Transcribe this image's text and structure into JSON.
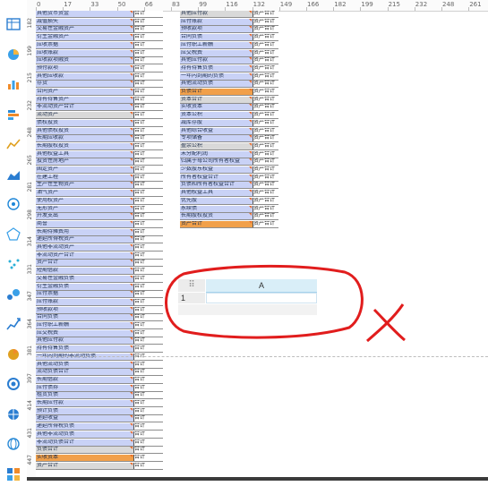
{
  "top_ruler": {
    "ticks": [
      "0",
      "17",
      "33",
      "50",
      "66",
      "83",
      "99",
      "116",
      "132",
      "149",
      "166",
      "182",
      "199",
      "215",
      "232",
      "248",
      "261"
    ]
  },
  "left_ruler": {
    "ticks": [
      "182",
      "199",
      "215",
      "232",
      "248",
      "265",
      "281",
      "298",
      "314",
      "331",
      "347",
      "364",
      "381",
      "397",
      "414",
      "431",
      "447"
    ]
  },
  "toolbar": {
    "icons": [
      "table-icon",
      "pie-chart-icon",
      "bar-chart-icon",
      "horizontal-bar-icon",
      "line-chart-icon",
      "area-chart-icon",
      "radar-chart-icon",
      "scatter-chart-icon",
      "bubble-chart-icon",
      "network-chart-icon",
      "trend-chart-icon",
      "gauge-chart-icon",
      "funnel-chart-icon",
      "globe-icon",
      "geo-icon",
      "treemap-icon"
    ]
  },
  "left_sheet": {
    "value_text": "合计",
    "rows": [
      {
        "label": "其他货币资金"
      },
      {
        "label": "减值损失"
      },
      {
        "label": "交易性金融资产"
      },
      {
        "label": "衍生金融资产"
      },
      {
        "label": "应收票据"
      },
      {
        "label": "应收账款"
      },
      {
        "label": "应收款项融资"
      },
      {
        "label": "预付款项"
      },
      {
        "label": "其他应收款"
      },
      {
        "label": "存货"
      },
      {
        "label": "合同资产"
      },
      {
        "label": "持有待售资产"
      },
      {
        "label": "非流动资产合计"
      },
      {
        "label": "流动资产"
      },
      {
        "label": "债权投资"
      },
      {
        "label": "其他债权投资"
      },
      {
        "label": "长期应收款"
      },
      {
        "label": "长期股权投资"
      },
      {
        "label": "其他权益工具"
      },
      {
        "label": "投资性房地产"
      },
      {
        "label": "固定资产"
      },
      {
        "label": "在建工程"
      },
      {
        "label": "生产性生物资产"
      },
      {
        "label": "油气资产"
      },
      {
        "label": "使用权资产"
      },
      {
        "label": "无形资产"
      },
      {
        "label": "开发支出"
      },
      {
        "label": "商誉"
      },
      {
        "label": "长期待摊费用"
      },
      {
        "label": "递延所得税资产"
      },
      {
        "label": "其他非流动资产"
      },
      {
        "label": "非流动资产合计"
      },
      {
        "label": "资产合计"
      },
      {
        "label": "短期借款"
      },
      {
        "label": "交易性金融负债"
      },
      {
        "label": "衍生金融负债"
      },
      {
        "label": "应付票据"
      },
      {
        "label": "应付账款"
      },
      {
        "label": "预收款项"
      },
      {
        "label": "合同负债"
      },
      {
        "label": "应付职工薪酬"
      },
      {
        "label": "应交税费"
      },
      {
        "label": "其他应付款"
      },
      {
        "label": "持有待售负债"
      },
      {
        "label": "一年内到期的非流动负债"
      },
      {
        "label": "其他流动负债"
      },
      {
        "label": "流动负债合计"
      },
      {
        "label": "长期借款"
      },
      {
        "label": "应付债券"
      },
      {
        "label": "租赁负债"
      },
      {
        "label": "长期应付款"
      },
      {
        "label": "预计负债"
      },
      {
        "label": "递延收益"
      },
      {
        "label": "递延所得税负债"
      },
      {
        "label": "其他非流动负债"
      },
      {
        "label": "非流动负债合计"
      },
      {
        "label": "负债合计"
      },
      {
        "label": "实收资本"
      },
      {
        "label": "资产合计"
      }
    ]
  },
  "right_sheet": {
    "value_text": "资产合计",
    "rows": [
      {
        "label": "其他应付款"
      },
      {
        "label": "应付账款"
      },
      {
        "label": "预收款项"
      },
      {
        "label": "合同负债"
      },
      {
        "label": "应付职工薪酬"
      },
      {
        "label": "应交税费"
      },
      {
        "label": "其他应付款"
      },
      {
        "label": "持有待售负债"
      },
      {
        "label": "一年内到期的负债"
      },
      {
        "label": "其他流动负债"
      },
      {
        "label": "负债合计"
      },
      {
        "label": "资本合计"
      },
      {
        "label": "实收资本"
      },
      {
        "label": "资本公积"
      },
      {
        "label": "减库存股"
      },
      {
        "label": "其他综合收益"
      },
      {
        "label": "专项储备"
      },
      {
        "label": "盈余公积"
      },
      {
        "label": "未分配利润"
      },
      {
        "label": "归属于母公司所有者权益"
      },
      {
        "label": "少数股东权益"
      },
      {
        "label": "所有者权益合计"
      },
      {
        "label": "负债和所有者权益合计"
      },
      {
        "label": "其他权益工具"
      },
      {
        "label": "优先股"
      },
      {
        "label": "永续债"
      },
      {
        "label": "长期股权投资"
      },
      {
        "label": "资产合计"
      }
    ]
  },
  "widget": {
    "grip": "⠿",
    "column_header": "A",
    "row_number": "1",
    "cell_value": ""
  },
  "annotation": {
    "stroke_color": "#e11d1d"
  },
  "colors": {
    "row_fill": "#c9d2f6",
    "section_fill": "#d9d9d9",
    "total_fill": "#f1a04a",
    "accent_orange": "#e86a2a"
  }
}
